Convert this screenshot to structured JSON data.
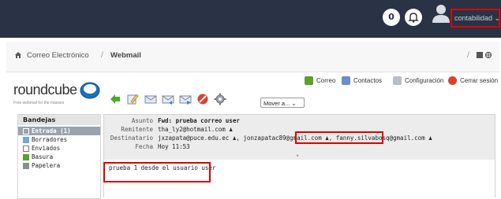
{
  "topbar": {
    "info_glyph": "0",
    "user_label": "contabilidad ⌄",
    "bg": "#293345",
    "icons": [
      "info-icon",
      "bell-icon",
      "user-avatar-icon"
    ]
  },
  "breadcrumb": {
    "home": "Correo Electrónico",
    "sep": "/",
    "current": "Webmail",
    "right_sep": "/"
  },
  "logo": {
    "word": "roundcube",
    "tagline": "Free webmail for the masses"
  },
  "topnav": {
    "mail": "Correo",
    "contacts": "Contactos",
    "settings": "Configuración",
    "logout": "Cerrar sesión"
  },
  "toolbar": {
    "icons": [
      "back-icon",
      "compose-icon",
      "reply-icon",
      "reply-all-icon",
      "forward-icon",
      "delete-icon",
      "more-gear-icon"
    ],
    "move_select": "Mover a... ⌄"
  },
  "sidebar": {
    "title": "Bandejas",
    "items": [
      {
        "label": "Entrada (1)",
        "active": true
      },
      {
        "label": "Borradores",
        "active": false
      },
      {
        "label": "Enviados",
        "active": false
      },
      {
        "label": "Basura",
        "active": false
      },
      {
        "label": "Papelera",
        "active": false
      }
    ]
  },
  "message": {
    "subject_label": "Asunto",
    "subject": "Fwd: prueba correo user",
    "sender_label": "Remitente",
    "sender": "tha_ly2@hotmail.com",
    "to_label": "Destinatario",
    "to_1": "jxzapata@puce.edu.ec",
    "to_2": "jonzapatac89@gmail.com",
    "to_3": "fanny.silvabosq@gmail.com",
    "date_label": "Fecha",
    "date": "Hoy 11:53",
    "expand_glyph": "▾",
    "body": "prueba 1 desde el usuario user"
  },
  "colors": {
    "highlight": "#e00000",
    "header_bg": "#ececec",
    "active_folder": "#9aa3ad"
  }
}
